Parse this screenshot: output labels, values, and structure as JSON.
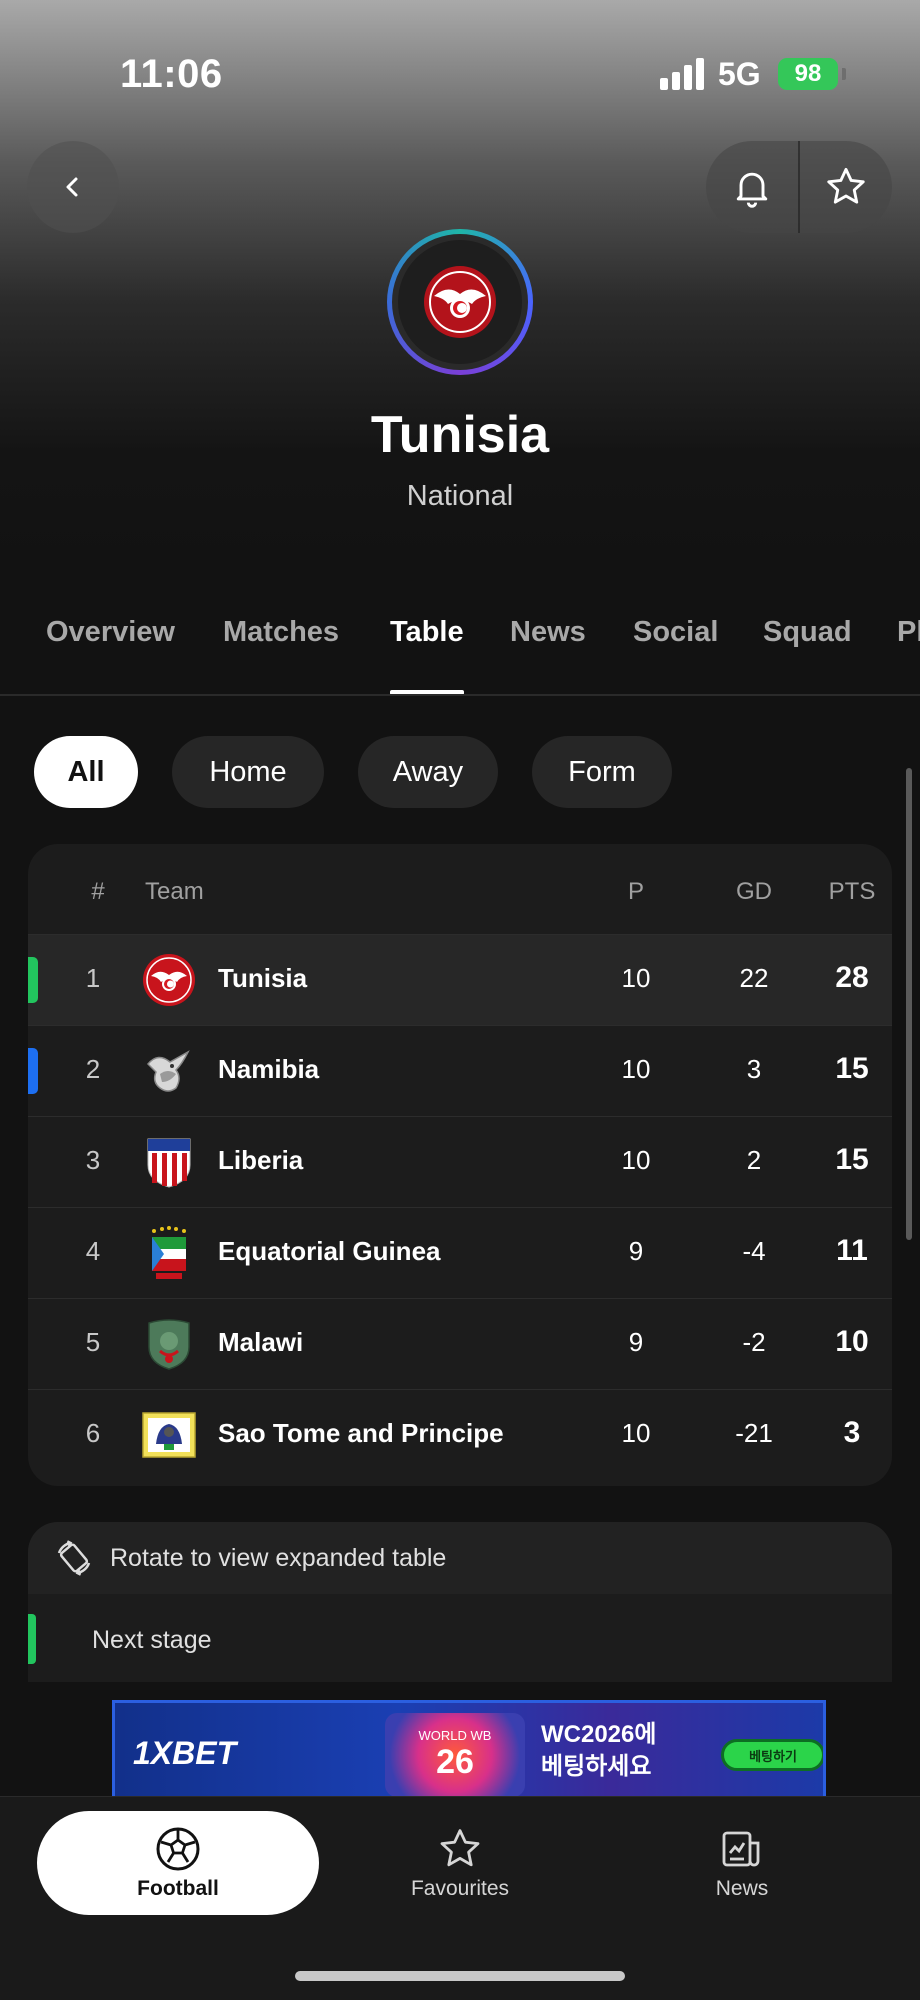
{
  "status_bar": {
    "time": "11:06",
    "network": "5G",
    "battery": "98"
  },
  "header": {
    "back_icon": "chevron-left-icon",
    "bell_icon": "bell-icon",
    "star_icon": "star-icon",
    "team_name": "Tunisia",
    "team_type": "National"
  },
  "tabs": [
    {
      "label": "Overview"
    },
    {
      "label": "Matches"
    },
    {
      "label": "Table",
      "active": true
    },
    {
      "label": "News"
    },
    {
      "label": "Social"
    },
    {
      "label": "Squad"
    },
    {
      "label": "Pl"
    }
  ],
  "filters": [
    {
      "label": "All",
      "active": true
    },
    {
      "label": "Home"
    },
    {
      "label": "Away"
    },
    {
      "label": "Form"
    }
  ],
  "table": {
    "headers": {
      "pos": "#",
      "team": "Team",
      "p": "P",
      "gd": "GD",
      "pts": "PTS"
    },
    "rows": [
      {
        "pos": "1",
        "team": "Tunisia",
        "p": "10",
        "gd": "22",
        "pts": "28",
        "qualification_color": "#22c55e"
      },
      {
        "pos": "2",
        "team": "Namibia",
        "p": "10",
        "gd": "3",
        "pts": "15",
        "qualification_color": "#1d6ff2"
      },
      {
        "pos": "3",
        "team": "Liberia",
        "p": "10",
        "gd": "2",
        "pts": "15"
      },
      {
        "pos": "4",
        "team": "Equatorial Guinea",
        "p": "9",
        "gd": "-4",
        "pts": "11"
      },
      {
        "pos": "5",
        "team": "Malawi",
        "p": "9",
        "gd": "-2",
        "pts": "10"
      },
      {
        "pos": "6",
        "team": "Sao Tome and Principe",
        "p": "10",
        "gd": "-21",
        "pts": "3"
      }
    ]
  },
  "rotate_hint": "Rotate to view expanded table",
  "legend": {
    "next_stage": "Next stage",
    "next_stage_color": "#22c55e"
  },
  "ad": {
    "brand": "1XBET",
    "badge_small": "WORLD WB",
    "badge_big": "26",
    "text_line1": "WC2026에",
    "text_line2": "베팅하세요",
    "cta": "베팅하기"
  },
  "bottom_nav": [
    {
      "label": "Football",
      "icon": "football-icon",
      "active": true
    },
    {
      "label": "Favourites",
      "icon": "star-icon"
    },
    {
      "label": "News",
      "icon": "news-icon"
    }
  ]
}
